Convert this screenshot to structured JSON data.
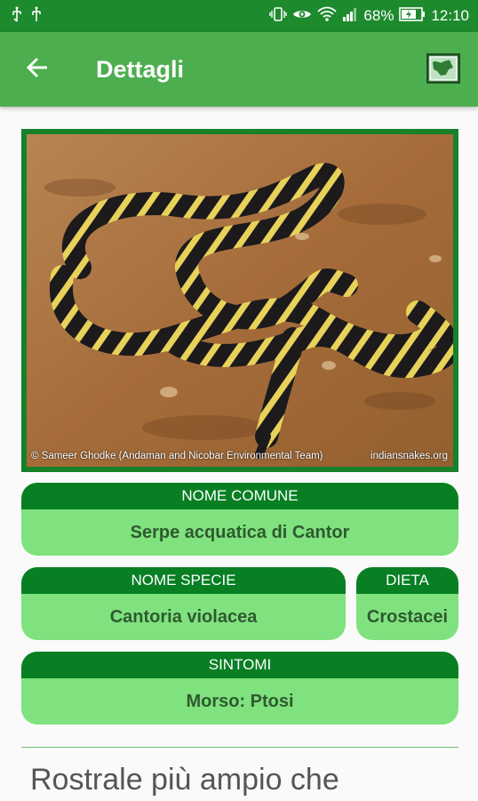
{
  "status_bar": {
    "battery": "68%",
    "time": "12:10",
    "icons": [
      "usb-icon",
      "usb-icon",
      "vibrate-icon",
      "eye-icon",
      "wifi-icon",
      "signal-icon",
      "battery-icon"
    ]
  },
  "app_bar": {
    "title": "Dettagli",
    "back_icon": "arrow-back-icon",
    "map_icon": "map-icon"
  },
  "photo": {
    "credit_left": "© Sameer Ghodke (Andaman and Nicobar Environmental Team)",
    "credit_right": "indiansnakes.org"
  },
  "cards": {
    "common_name": {
      "header": "NOME COMUNE",
      "value": "Serpe acquatica di Cantor"
    },
    "species_name": {
      "header": "NOME SPECIE",
      "value": "Cantoria violacea"
    },
    "diet": {
      "header": "DIETA",
      "value": "Crostacei"
    },
    "symptoms": {
      "header": "SINTOMI",
      "value": "Morso: Ptosi"
    }
  },
  "description": "Rostrale più ampio che",
  "colors": {
    "status_bar": "#1e8a2e",
    "app_bar": "#4cae4f",
    "card_header": "#087f23",
    "card_body": "#80e27e",
    "card_text": "#2e5a30"
  }
}
